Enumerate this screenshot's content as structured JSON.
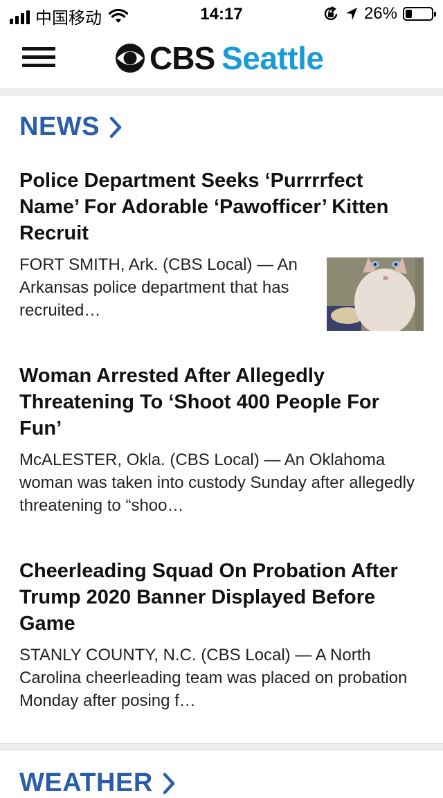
{
  "status_bar": {
    "carrier": "中国移动",
    "time": "14:17",
    "battery": "26%",
    "battery_level": 0.26,
    "icons": [
      "signal-icon",
      "wifi-icon",
      "orientation-lock-icon",
      "location-arrow-icon",
      "battery-icon"
    ]
  },
  "header": {
    "logo_brand": "CBS",
    "logo_city": "Seattle",
    "menu_icon": "hamburger-menu-icon",
    "colors": {
      "brand_dark": "#111111",
      "brand_accent": "#1a9bd7"
    }
  },
  "news_section": {
    "title": "NEWS",
    "title_color": "#2b5ea9",
    "articles": [
      {
        "headline": "Police Department Seeks ‘Purrrrfect Name’ For Adorable ‘Pawofficer’ Kitten Recruit",
        "summary": "FORT SMITH, Ark. (CBS Local) — An Arkansas police department that has recruited…",
        "thumbnail": "kitten-photo"
      },
      {
        "headline": "Woman Arrested After Allegedly Threatening To ‘Shoot 400 People For Fun’",
        "summary": "McALESTER, Okla. (CBS Local) — An Oklahoma woman was taken into custody Sunday after allegedly threatening to “shoo…"
      },
      {
        "headline": "Cheerleading Squad On Probation After Trump 2020 Banner Displayed Before Game",
        "summary": "STANLY COUNTY, N.C. (CBS Local) — A North Carolina cheerleading team was placed on probation Monday after posing f…"
      }
    ]
  },
  "weather_section": {
    "title": "WEATHER"
  }
}
